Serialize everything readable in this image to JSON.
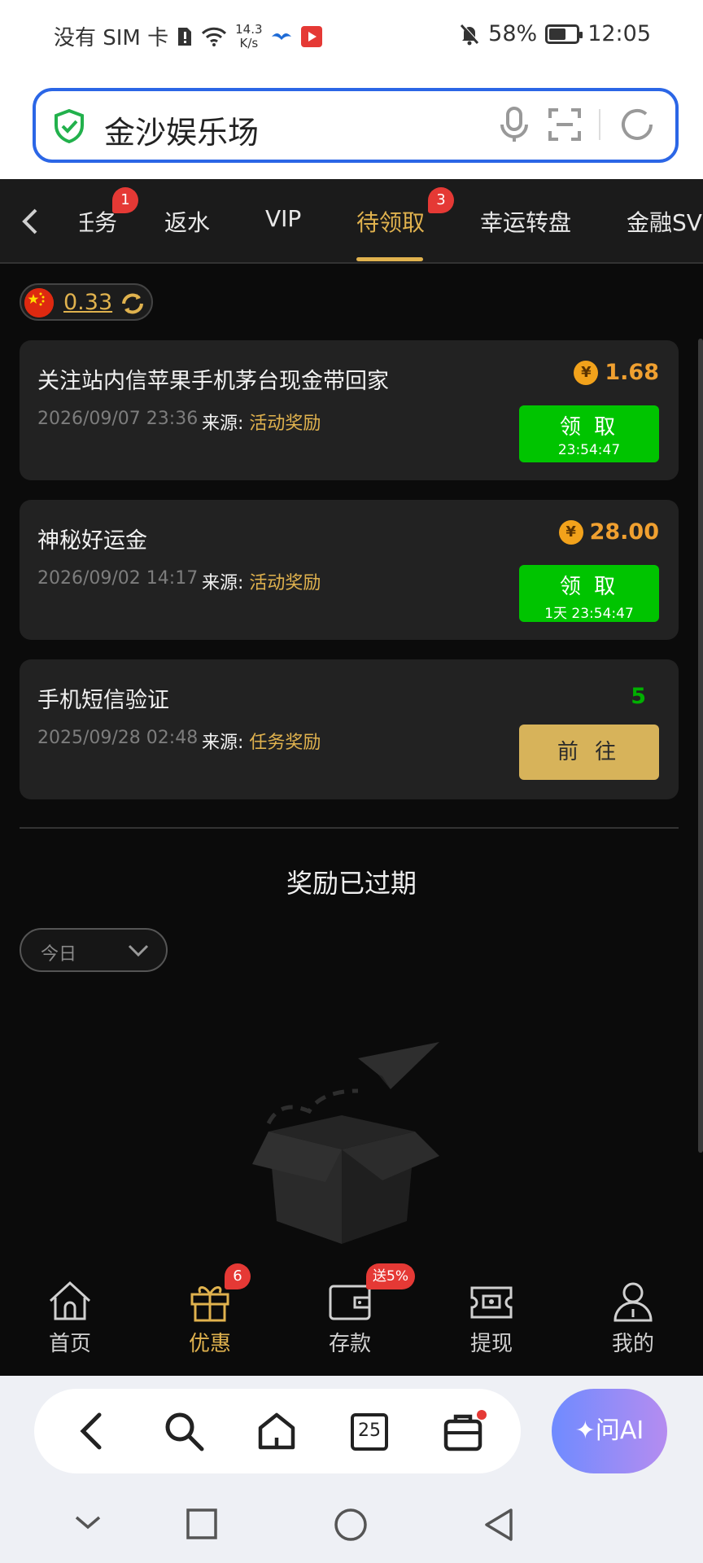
{
  "status_bar": {
    "carrier": "没有 SIM 卡",
    "speed_top": "14.3",
    "speed_bottom": "K/s",
    "battery_percent": "58%",
    "battery_level": 0.58,
    "time": "12:05"
  },
  "search": {
    "query": "金沙娱乐场"
  },
  "tabs": [
    {
      "label": "任务",
      "badge": "1"
    },
    {
      "label": "返水"
    },
    {
      "label": "VIP"
    },
    {
      "label": "待领取",
      "badge": "3",
      "active": true
    },
    {
      "label": "幸运转盘"
    },
    {
      "label": "金融SVIP"
    }
  ],
  "balance": {
    "amount": "0.33"
  },
  "rewards": [
    {
      "title": "关注站内信苹果手机茅台现金带回家",
      "date": "2026/09/07 23:36",
      "source_label": "来源:",
      "source": "活动奖励",
      "amount": "1.68",
      "button_label": "领 取",
      "button_sub": "23:54:47"
    },
    {
      "title": "神秘好运金",
      "date": "2026/09/02 14:17",
      "source_label": "来源:",
      "source": "活动奖励",
      "amount": "28.00",
      "button_label": "领 取",
      "button_sub": "1天 23:54:47"
    },
    {
      "title": "手机短信验证",
      "date": "2025/09/28 02:48",
      "source_label": "来源:",
      "source": "任务奖励",
      "points": "5",
      "button_label": "前 往"
    }
  ],
  "coin_symbol": "¥",
  "expired": {
    "title": "奖励已过期",
    "filter_value": "今日"
  },
  "bottom_nav": [
    {
      "label": "首页",
      "icon": "home-icon"
    },
    {
      "label": "优惠",
      "icon": "gift-icon",
      "badge": "6",
      "active": true
    },
    {
      "label": "存款",
      "icon": "wallet-icon",
      "badge": "送5%"
    },
    {
      "label": "提现",
      "icon": "cash-icon"
    },
    {
      "label": "我的",
      "icon": "profile-icon"
    }
  ],
  "browser": {
    "tabs_count": "25",
    "ai_label": "问AI"
  },
  "colors": {
    "accent_gold": "#e0b24e",
    "claim_green": "#00c400",
    "badge_red": "#e53935",
    "search_border": "#2b66e6"
  }
}
